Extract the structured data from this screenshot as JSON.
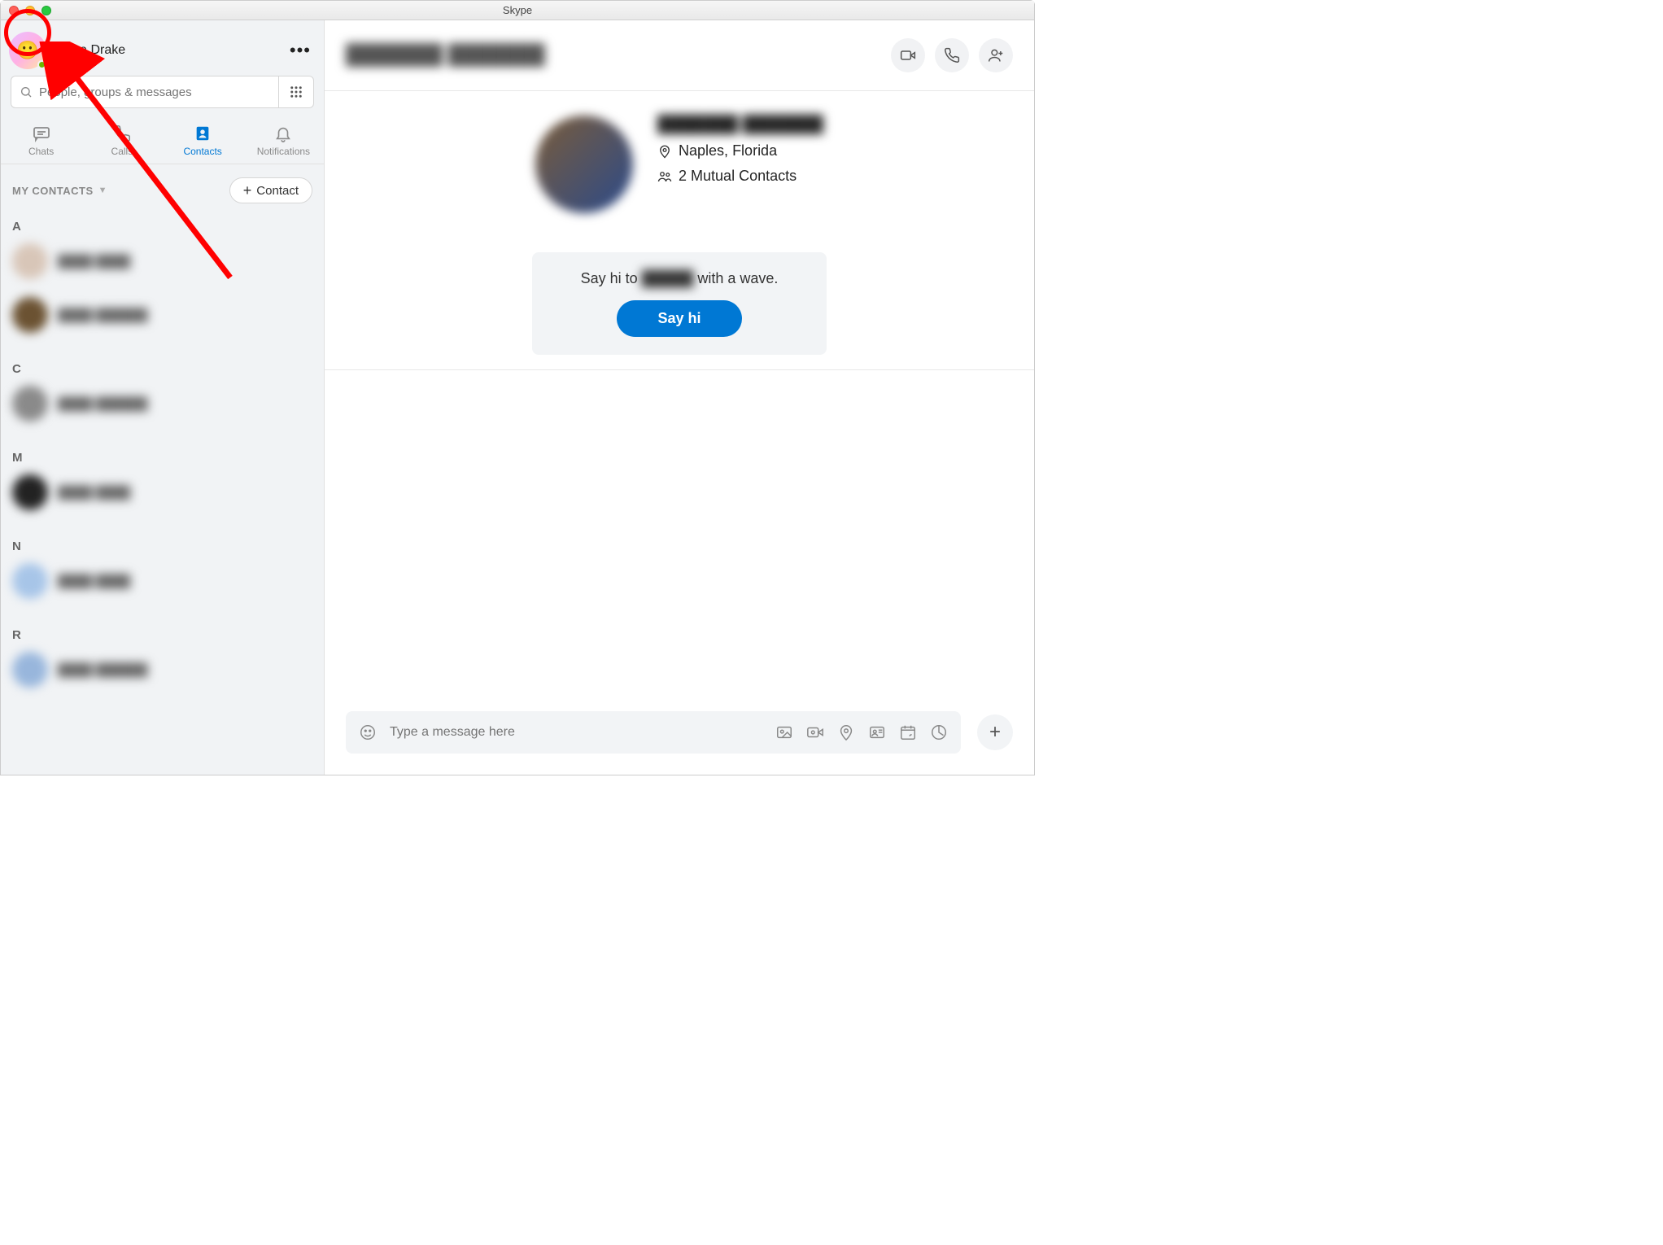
{
  "app": {
    "title": "Skype"
  },
  "sidebar": {
    "user": {
      "name": "Alexa Drake",
      "status": "online",
      "emoji": "🙂"
    },
    "search": {
      "placeholder": "People, groups & messages"
    },
    "tabs": [
      {
        "id": "chats",
        "label": "Chats"
      },
      {
        "id": "calls",
        "label": "Calls"
      },
      {
        "id": "contacts",
        "label": "Contacts"
      },
      {
        "id": "notifications",
        "label": "Notifications"
      }
    ],
    "active_tab": "contacts",
    "section_title": "MY CONTACTS",
    "add_contact_label": "Contact",
    "groups": [
      {
        "letter": "A",
        "items": [
          {
            "id": "a1",
            "name": "████ ████",
            "avatar": "#d8c6b8"
          },
          {
            "id": "a2",
            "name": "████ ██████",
            "avatar": "#6b5232"
          }
        ]
      },
      {
        "letter": "C",
        "items": [
          {
            "id": "c1",
            "name": "████ ██████",
            "avatar": "#8a8a8a"
          }
        ]
      },
      {
        "letter": "M",
        "items": [
          {
            "id": "m1",
            "name": "████ ████",
            "avatar": "#222222"
          }
        ]
      },
      {
        "letter": "N",
        "items": [
          {
            "id": "n1",
            "name": "████ ████",
            "avatar": "#a7c5e8"
          }
        ]
      },
      {
        "letter": "R",
        "items": [
          {
            "id": "r1",
            "name": "████ ██████",
            "avatar": "#98b6dc"
          }
        ]
      }
    ]
  },
  "chat": {
    "header_name": "███████ ███████",
    "location": "Naples, Florida",
    "mutual": "2 Mutual Contacts",
    "wave_text_prefix": "Say hi to ",
    "wave_name": "█████",
    "wave_text_suffix": " with a wave.",
    "sayhi_label": "Say hi",
    "composer_placeholder": "Type a message here"
  },
  "colors": {
    "accent": "#0078d4",
    "sidebar_bg": "#f1f3f5"
  }
}
